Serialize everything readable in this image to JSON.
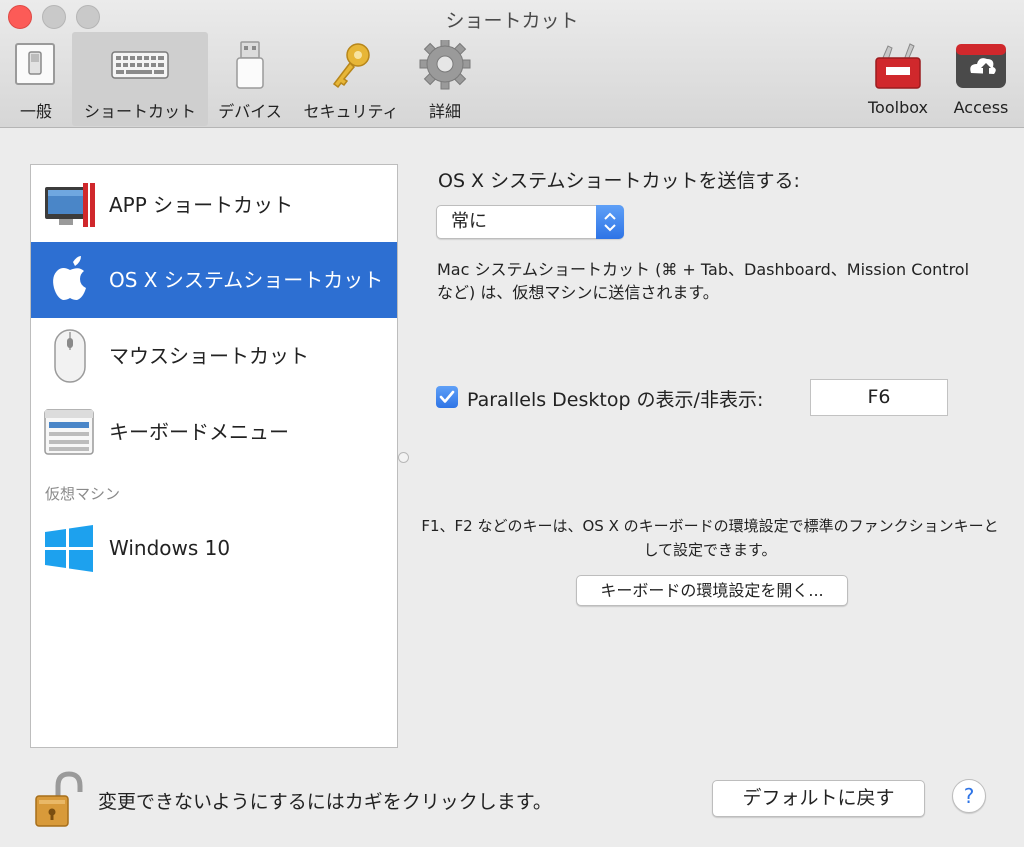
{
  "window": {
    "title": "ショートカット"
  },
  "toolbar": {
    "items": [
      {
        "label": "一般",
        "icon": "switch-icon"
      },
      {
        "label": "ショートカット",
        "icon": "keyboard-icon",
        "selected": true
      },
      {
        "label": "デバイス",
        "icon": "usb-icon"
      },
      {
        "label": "セキュリティ",
        "icon": "key-icon"
      },
      {
        "label": "詳細",
        "icon": "gear-icon"
      },
      {
        "label": "Toolbox",
        "icon": "toolbox-icon"
      },
      {
        "label": "Access",
        "icon": "parallels-access-icon"
      }
    ]
  },
  "sidebar": {
    "items": [
      {
        "label": "APP ショートカット",
        "icon": "app-window-icon"
      },
      {
        "label": "OS X システムショートカット",
        "icon": "apple-icon",
        "selected": true
      },
      {
        "label": "マウスショートカット",
        "icon": "mouse-icon"
      },
      {
        "label": "キーボードメニュー",
        "icon": "keyboard-menu-icon"
      }
    ],
    "group_header": "仮想マシン",
    "vm_items": [
      {
        "label": "Windows 10",
        "icon": "windows-icon"
      }
    ]
  },
  "main": {
    "heading": "OS X システムショートカットを送信する:",
    "send_popup": {
      "value": "常に"
    },
    "description": "Mac システムショートカット (⌘ + Tab、Dashboard、Mission Control など) は、仮想マシンに送信されます。",
    "toggle": {
      "checked": true,
      "label": "Parallels Desktop の表示/非表示:",
      "key": "F6"
    },
    "note": "F1、F2 などのキーは、OS X のキーボードの環境設定で標準のファンクションキーとして設定できます。",
    "keyboard_prefs_button": "キーボードの環境設定を開く..."
  },
  "footer": {
    "lock_text": "変更できないようにするにはカギをクリックします。",
    "default_button": "デフォルトに戻す",
    "help_label": "?"
  },
  "colors": {
    "selection": "#2d6fd2",
    "accent": "#2e74e6",
    "close_button": "#fc5b57",
    "parallels_red": "#d0282c"
  }
}
